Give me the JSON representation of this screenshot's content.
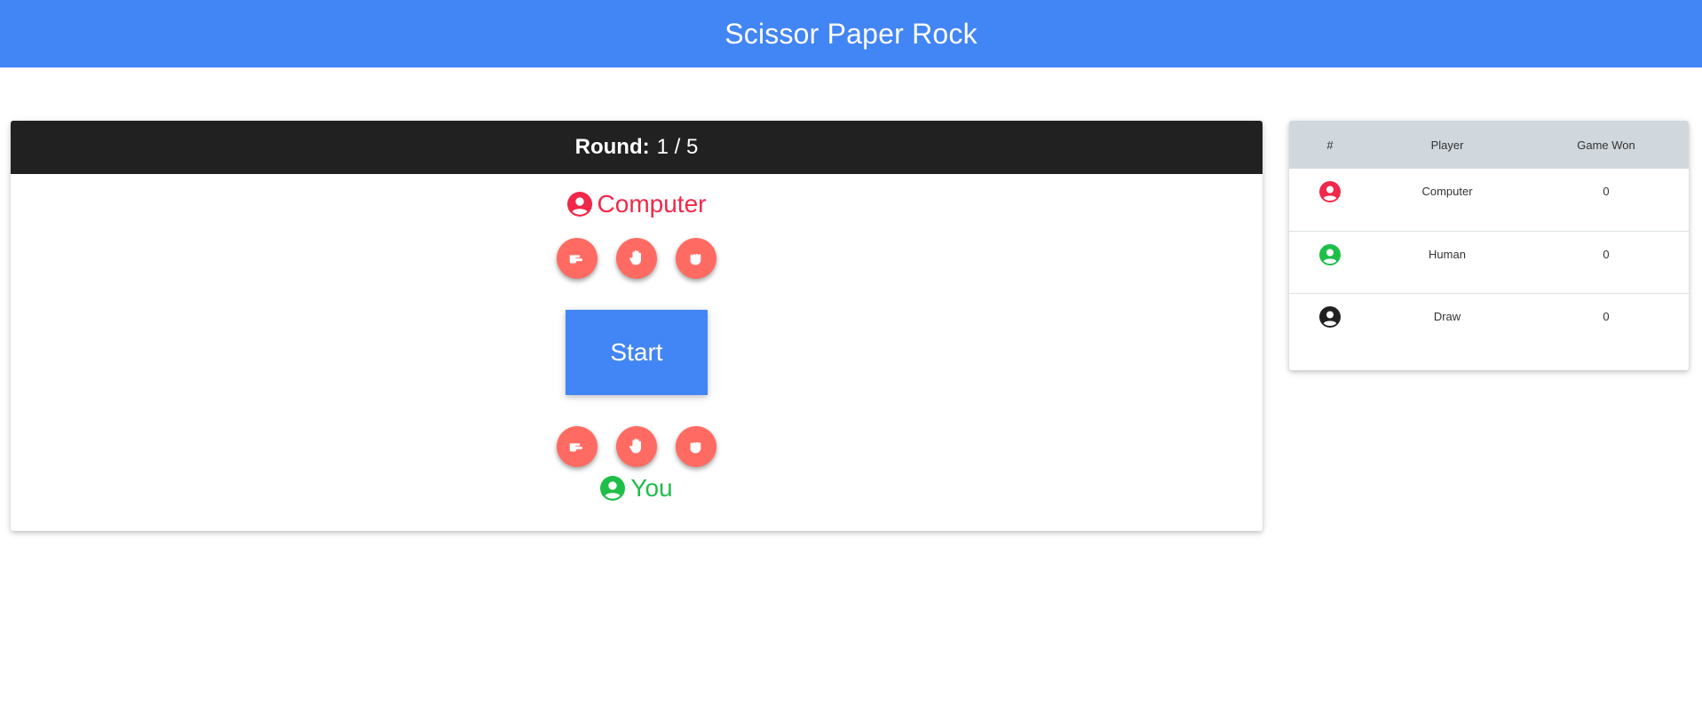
{
  "header": {
    "title": "Scissor Paper Rock"
  },
  "colors": {
    "header_bg": "#4285f4",
    "round_bar_bg": "#212121",
    "computer": "#f02849",
    "human": "#1fbe49",
    "draw": "#212121",
    "hand_button": "#ff6b62",
    "start_button": "#4285f4"
  },
  "game": {
    "round_label": "Round:",
    "round_value": "1 / 5",
    "computer_name": "Computer",
    "you_name": "You",
    "hand_icons": [
      "scissors-icon",
      "paper-icon",
      "rock-icon"
    ],
    "start_label": "Start"
  },
  "scoreboard": {
    "headers": [
      "#",
      "Player",
      "Game Won"
    ],
    "rows": [
      {
        "icon": "user-circle-icon",
        "player": "Computer",
        "won": "0"
      },
      {
        "icon": "user-circle-icon",
        "player": "Human",
        "won": "0"
      },
      {
        "icon": "user-circle-icon",
        "player": "Draw",
        "won": "0"
      }
    ]
  }
}
